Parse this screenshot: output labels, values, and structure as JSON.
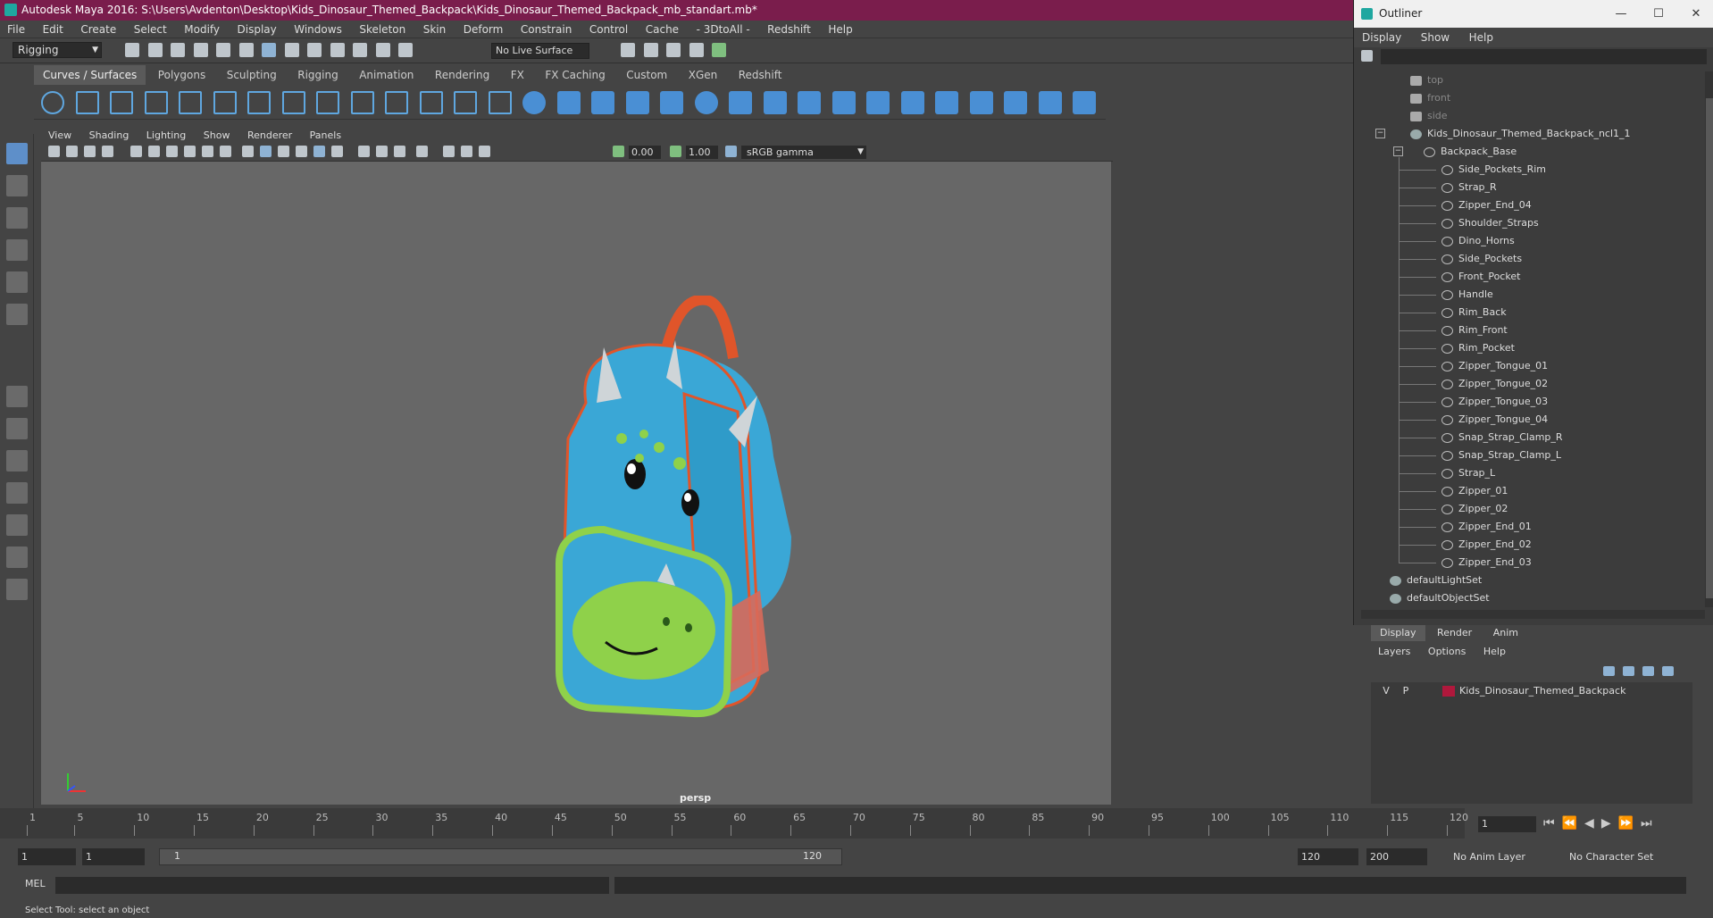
{
  "window": {
    "title": "Autodesk Maya 2016: S:\\Users\\Avdenton\\Desktop\\Kids_Dinosaur_Themed_Backpack\\Kids_Dinosaur_Themed_Backpack_mb_standart.mb*"
  },
  "menubar": [
    "File",
    "Edit",
    "Create",
    "Select",
    "Modify",
    "Display",
    "Windows",
    "Skeleton",
    "Skin",
    "Deform",
    "Constrain",
    "Control",
    "Cache",
    "- 3DtoAll -",
    "Redshift",
    "Help"
  ],
  "statusline": {
    "mode": "Rigging",
    "live_surface": "No Live Surface"
  },
  "shelf": {
    "tabs": [
      "Curves / Surfaces",
      "Polygons",
      "Sculpting",
      "Rigging",
      "Animation",
      "Rendering",
      "FX",
      "FX Caching",
      "Custom",
      "XGen",
      "Redshift"
    ],
    "active_tab": "Curves / Surfaces"
  },
  "viewport": {
    "menu": [
      "View",
      "Shading",
      "Lighting",
      "Show",
      "Renderer",
      "Panels"
    ],
    "exposure": "0.00",
    "gamma": "1.00",
    "color_space": "sRGB gamma",
    "camera_label": "persp"
  },
  "outliner": {
    "title": "Outliner",
    "menu": [
      "Display",
      "Show",
      "Help"
    ],
    "cameras": [
      "top",
      "front",
      "side"
    ],
    "root": "Kids_Dinosaur_Themed_Backpack_ncl1_1",
    "group": "Backpack_Base",
    "children": [
      "Side_Pockets_Rim",
      "Strap_R",
      "Zipper_End_04",
      "Shoulder_Straps",
      "Dino_Horns",
      "Side_Pockets",
      "Front_Pocket",
      "Handle",
      "Rim_Back",
      "Rim_Front",
      "Rim_Pocket",
      "Zipper_Tongue_01",
      "Zipper_Tongue_02",
      "Zipper_Tongue_03",
      "Zipper_Tongue_04",
      "Snap_Strap_Clamp_R",
      "Snap_Strap_Clamp_L",
      "Strap_L",
      "Zipper_01",
      "Zipper_02",
      "Zipper_End_01",
      "Zipper_End_02",
      "Zipper_End_03"
    ],
    "sets": [
      "defaultLightSet",
      "defaultObjectSet"
    ]
  },
  "layer_editor": {
    "tabs": [
      "Display",
      "Render",
      "Anim"
    ],
    "active_tab": "Display",
    "menu": [
      "Layers",
      "Options",
      "Help"
    ],
    "layers": [
      {
        "v": "V",
        "p": "P",
        "name": "Kids_Dinosaur_Themed_Backpack",
        "color": "#b0183c"
      }
    ]
  },
  "timeline": {
    "tick_labels": [
      "1",
      "5",
      "10",
      "15",
      "20",
      "25",
      "30",
      "35",
      "40",
      "45",
      "50",
      "55",
      "60",
      "65",
      "70",
      "75",
      "80",
      "85",
      "90",
      "95",
      "100",
      "105",
      "110",
      "115",
      "120"
    ],
    "current_frame": "1"
  },
  "range": {
    "start_a": "1",
    "start_b": "1",
    "slider_left": "1",
    "slider_right": "120",
    "end_a": "120",
    "end_b": "200",
    "anim_layer": "No Anim Layer",
    "char_set": "No Character Set"
  },
  "command": {
    "label": "MEL",
    "help": "Select Tool: select an object"
  },
  "colors": {
    "title_bar": "#7a1d4c",
    "viewport_bg": "#676767",
    "panel_bg": "#444444",
    "layer_color": "#b0183c"
  }
}
